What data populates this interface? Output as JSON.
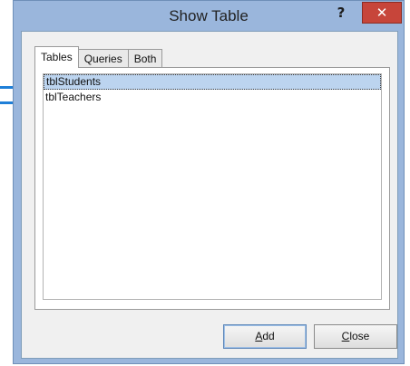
{
  "window": {
    "title": "Show Table",
    "help_label": "?",
    "close_label": "✕"
  },
  "tabs": [
    {
      "label": "Tables",
      "active": true
    },
    {
      "label": "Queries",
      "active": false
    },
    {
      "label": "Both",
      "active": false
    }
  ],
  "list": {
    "items": [
      {
        "label": "tblStudents",
        "selected": true
      },
      {
        "label": "tblTeachers",
        "selected": false
      }
    ]
  },
  "buttons": {
    "add": {
      "mnemonic": "A",
      "rest": "dd"
    },
    "close": {
      "mnemonic": "C",
      "rest": "lose"
    }
  },
  "annotations": {
    "arrow_color": "#1e7fd8"
  },
  "colors": {
    "frame": "#9ab6dc",
    "close_button": "#c7453a",
    "selection": "#bcd4ef"
  }
}
